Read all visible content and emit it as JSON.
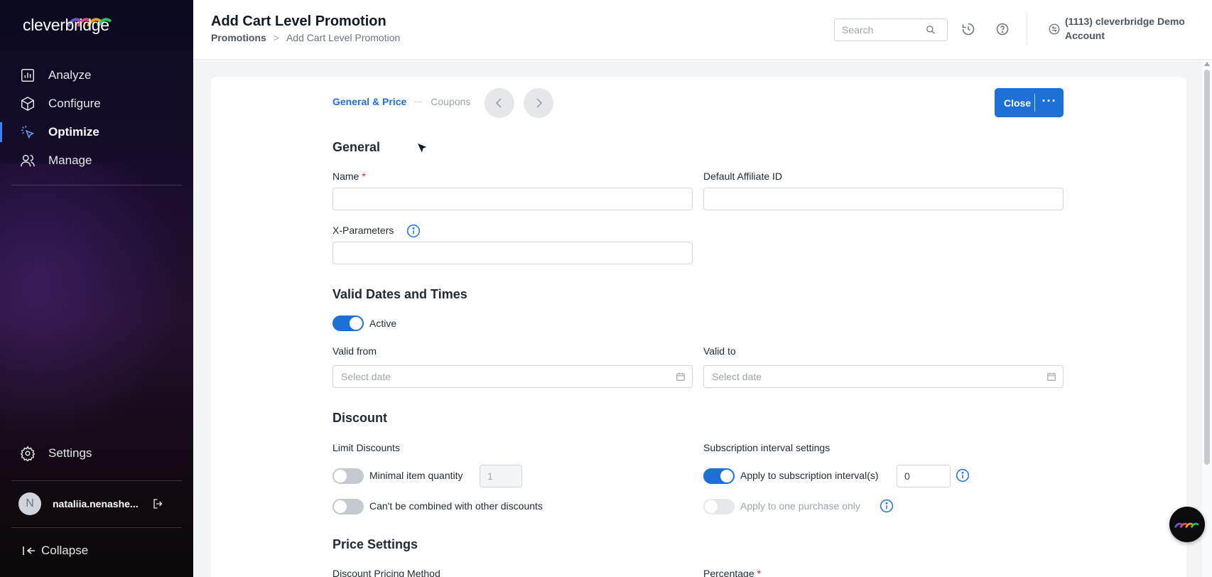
{
  "app": {
    "brand": "cleverbridge"
  },
  "sidebar": {
    "nav": [
      {
        "label": "Analyze",
        "icon": "chart-icon"
      },
      {
        "label": "Configure",
        "icon": "cube-icon"
      },
      {
        "label": "Optimize",
        "icon": "sparkle-cursor-icon",
        "active": true
      },
      {
        "label": "Manage",
        "icon": "users-icon"
      }
    ],
    "settings_label": "Settings",
    "user": {
      "initial": "N",
      "name": "nataliia.nenashe..."
    },
    "collapse_label": "Collapse"
  },
  "header": {
    "title": "Add Cart Level Promotion",
    "breadcrumb": {
      "parent": "Promotions",
      "separator": ">",
      "current": "Add Cart Level Promotion"
    },
    "search_placeholder": "Search",
    "account": "(1113) cleverbridge Demo Account"
  },
  "steps": {
    "active": "General & Price",
    "next": "Coupons"
  },
  "actions": {
    "close_label": "Close",
    "more_label": "···"
  },
  "general": {
    "title": "General",
    "name_label": "Name",
    "name_value": "",
    "affiliate_label": "Default Affiliate ID",
    "affiliate_value": "",
    "xparams_label": "X-Parameters",
    "xparams_value": ""
  },
  "dates": {
    "title": "Valid Dates and Times",
    "active_label": "Active",
    "active_on": true,
    "valid_from_label": "Valid from",
    "valid_from_placeholder": "Select date",
    "valid_to_label": "Valid to",
    "valid_to_placeholder": "Select date"
  },
  "discount": {
    "title": "Discount",
    "limit_label": "Limit Discounts",
    "min_qty_label": "Minimal item quantity",
    "min_qty_value": "1",
    "not_combined_label": "Can't be combined with other discounts",
    "sub_label": "Subscription interval settings",
    "apply_interval_label": "Apply to subscription interval(s)",
    "apply_interval_value": "0",
    "one_purchase_label": "Apply to one purchase only"
  },
  "price": {
    "title": "Price Settings",
    "method_label": "Discount Pricing Method",
    "percentage_label": "Percentage"
  },
  "colors": {
    "accent": "#1d70d6",
    "required": "#dc2626"
  }
}
